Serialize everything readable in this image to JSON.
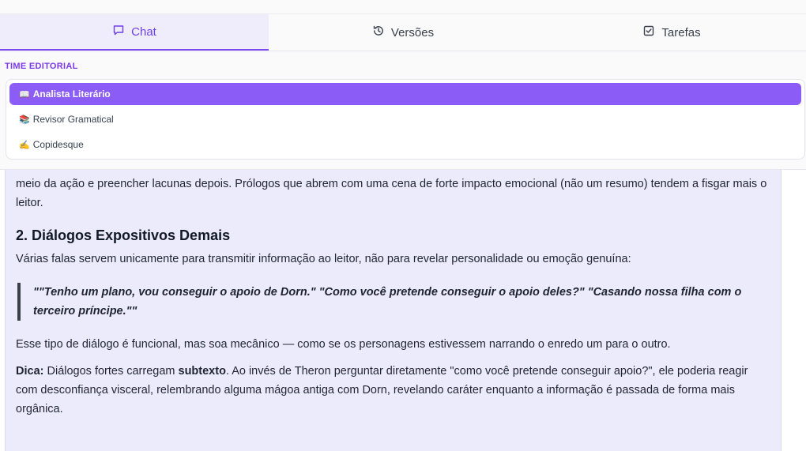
{
  "tabs": [
    {
      "label": "Chat",
      "icon": "chat-icon",
      "active": true
    },
    {
      "label": "Versões",
      "icon": "history-icon",
      "active": false
    },
    {
      "label": "Tarefas",
      "icon": "checkbox-icon",
      "active": false
    }
  ],
  "team": {
    "title": "TIME EDITORIAL",
    "agents": [
      {
        "emoji": "📖",
        "label": "Analista Literário",
        "selected": true
      },
      {
        "emoji": "📚",
        "label": "Revisor Gramatical",
        "selected": false
      },
      {
        "emoji": "✍",
        "label": "Copidesque",
        "selected": false
      }
    ]
  },
  "message": {
    "intro": "meio da ação e preencher lacunas depois. Prólogos que abrem com uma cena de forte impacto emocional (não um resumo) tendem a fisgar mais o leitor.",
    "section_heading": "2. Diálogos Expositivos Demais",
    "section_text": "Várias falas servem unicamente para transmitir informação ao leitor, não para revelar personalidade ou emoção genuína:",
    "quote": "\"\"Tenho um plano, vou conseguir o apoio de Dorn.\" \"Como você pretende conseguir o apoio deles?\" \"Casando nossa filha com o terceiro príncipe.\"\"",
    "observation": "Esse tipo de diálogo é funcional, mas soa mecânico — como se os personagens estivessem narrando o enredo um para o outro.",
    "tip_label": "Dica:",
    "tip_text_1": " Diálogos fortes carregam ",
    "tip_bold": "subtexto",
    "tip_text_2": ". Ao invés de Theron perguntar diretamente \"como você pretende conseguir apoio?\", ele poderia reagir com desconfiança visceral, relembrando alguma mágoa antiga com Dorn, revelando caráter enquanto a informação é passada de forma mais orgânica."
  },
  "colors": {
    "accent": "#7c4cf2",
    "selected_agent": "#8b5cf6",
    "content_bg": "#ecebfb"
  }
}
